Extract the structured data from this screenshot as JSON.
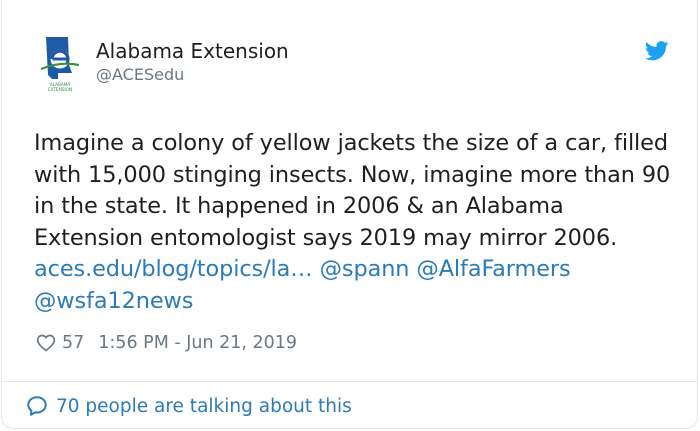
{
  "author": {
    "name": "Alabama Extension",
    "handle": "@ACESedu",
    "logo_text": "ALABAMA EXTENSION"
  },
  "tweet": {
    "text": "Imagine a colony of yellow jackets the size of a car, filled with 15,000 stinging insects. Now, imagine more than 90 in the state. It happened in 2006 & an Alabama Extension entomologist says 2019 may mirror 2006.",
    "link": "aces.edu/blog/topics/la…",
    "mention_1": "@spann",
    "mention_2": "@AlfaFarmers",
    "mention_3": "@wsfa12news"
  },
  "meta": {
    "likes": "57",
    "timestamp": "1:56 PM - Jun 21, 2019"
  },
  "footer": {
    "label": "70 people are talking about this"
  },
  "colors": {
    "link": "#2b7bb9",
    "twitter_blue": "#1da1f2",
    "secondary_text": "#697882",
    "logo_blue": "#1f5aa6",
    "logo_green": "#3a8f3e"
  },
  "icons": {
    "brand": "twitter-bird-icon",
    "like": "heart-icon",
    "conversation": "speech-bubble-icon"
  }
}
